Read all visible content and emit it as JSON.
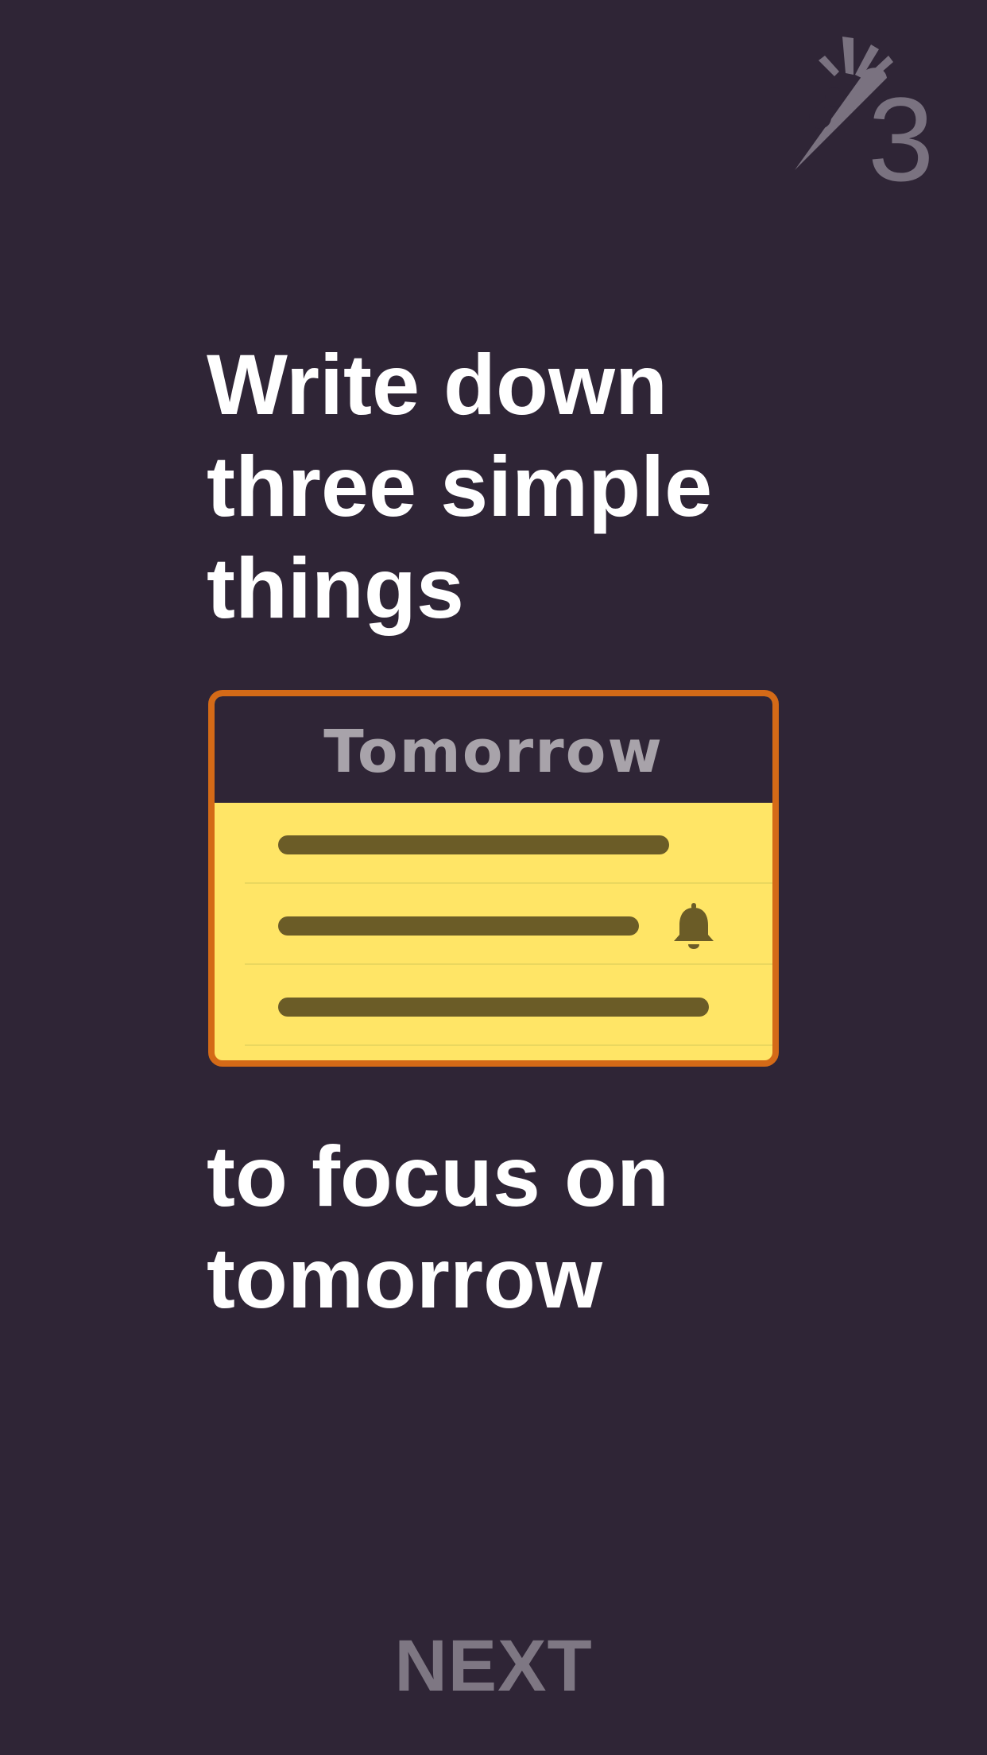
{
  "logo": {
    "icon": "carrot-icon",
    "digit": "3",
    "color": "#7a7280"
  },
  "headline_top": [
    "Write down",
    "three simple",
    "things"
  ],
  "card": {
    "title": "Tomorrow",
    "border_color": "#d46a17",
    "fill_color": "#ffe566",
    "header_color": "#2f2536",
    "rows": [
      {
        "has_reminder": false
      },
      {
        "has_reminder": true,
        "reminder_icon": "bell-icon"
      },
      {
        "has_reminder": false
      }
    ]
  },
  "headline_bottom": [
    "to focus on",
    "tomorrow"
  ],
  "next_label": "NEXT",
  "colors": {
    "background": "#2f2536",
    "text": "#ffffff",
    "muted": "#7e7783"
  }
}
